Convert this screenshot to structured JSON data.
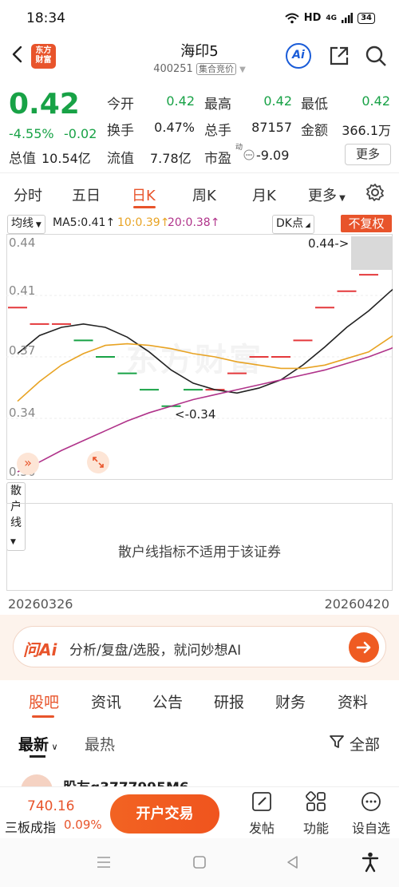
{
  "status_bar": {
    "time": "18:34",
    "network": "HD",
    "signal": "4G",
    "battery": "34"
  },
  "header": {
    "stock_name": "海印5",
    "stock_code": "400251",
    "trade_mode": "集合竞价",
    "logo_text_1": "东方",
    "logo_text_2": "财富",
    "ai_label": "Ai"
  },
  "quote": {
    "price": "0.42",
    "change_pct": "-4.55%",
    "change": "-0.02",
    "open_label": "今开",
    "open": "0.42",
    "high_label": "最高",
    "high": "0.42",
    "low_label": "最低",
    "low": "0.42",
    "turnover_label": "换手",
    "turnover": "0.47%",
    "volume_label": "总手",
    "volume": "87157",
    "amount_label": "金额",
    "amount": "366.1万",
    "total_mv_label": "总值",
    "total_mv": "10.54亿",
    "float_mv_label": "流值",
    "float_mv": "7.78亿",
    "pe_label": "市盈",
    "pe_sup": "动",
    "pe": "-9.09",
    "more_label": "更多"
  },
  "tabs": [
    "分时",
    "五日",
    "日K",
    "周K",
    "月K",
    "更多"
  ],
  "active_tab": "日K",
  "chart_toolbar": {
    "ma_select": "均线",
    "ma5": "MA5:0.41↑",
    "ma10": "10:0.39↑",
    "ma20": "20:0.38↑",
    "dk": "DK点",
    "adjust": "不复权"
  },
  "chart": {
    "y_labels": [
      "0.44",
      "0.41",
      "0.37",
      "0.34",
      "0.30"
    ],
    "max_marker": "0.44->",
    "min_marker": "<-0.34",
    "watermark": "东方财富",
    "colors": {
      "up": "#e4393c",
      "down": "#18a246",
      "ma5": "#222222",
      "ma10": "#e8a323",
      "ma20": "#b0338a"
    }
  },
  "chart_data": {
    "type": "candlestick",
    "ylim": [
      0.3,
      0.44
    ],
    "ohlc": [
      0.4,
      0.39,
      0.39,
      0.38,
      0.37,
      0.36,
      0.35,
      0.34,
      0.35,
      0.35,
      0.36,
      0.37,
      0.37,
      0.38,
      0.4,
      0.41,
      0.42,
      0.43,
      0.44,
      0.42
    ],
    "direction": [
      "up",
      "up",
      "up",
      "down",
      "down",
      "down",
      "down",
      "down",
      "down",
      "up",
      "up",
      "up",
      "up",
      "up",
      "up",
      "up",
      "up",
      "up",
      "up",
      "down"
    ],
    "series": [
      {
        "name": "MA5",
        "values": [
          0.372,
          0.383,
          0.388,
          0.39,
          0.388,
          0.382,
          0.373,
          0.362,
          0.354,
          0.35,
          0.348,
          0.351,
          0.356,
          0.365,
          0.376,
          0.388,
          0.398,
          0.41,
          0.421,
          0.426
        ]
      },
      {
        "name": "MA10",
        "values": [
          0.343,
          0.355,
          0.365,
          0.372,
          0.377,
          0.378,
          0.377,
          0.375,
          0.372,
          0.37,
          0.367,
          0.365,
          0.363,
          0.363,
          0.365,
          0.369,
          0.373,
          0.382,
          0.39,
          0.395
        ]
      },
      {
        "name": "MA20",
        "values": [
          0.3,
          0.306,
          0.313,
          0.319,
          0.325,
          0.331,
          0.336,
          0.34,
          0.344,
          0.347,
          0.35,
          0.353,
          0.356,
          0.359,
          0.362,
          0.366,
          0.37,
          0.375,
          0.381,
          0.385
        ]
      }
    ]
  },
  "indicator": {
    "select": "散户线",
    "message": "散户线指标不适用于该证券"
  },
  "dates": {
    "start": "20260326",
    "end": "20260420"
  },
  "ai_bar": {
    "brand": "问Ai",
    "text": "分析/复盘/选股，就问妙想AI"
  },
  "sub_tabs": [
    "股吧",
    "资讯",
    "公告",
    "研报",
    "财务",
    "资料"
  ],
  "sort": {
    "latest": "最新",
    "hot": "最热",
    "filter": "全部"
  },
  "post": {
    "user": "股友q3777995M6"
  },
  "bottom_bar": {
    "index_value": "740.16",
    "index_name": "三板成指",
    "index_pct": "0.09%",
    "trade": "开户交易",
    "post": "发帖",
    "function": "功能",
    "watchlist": "设自选"
  }
}
